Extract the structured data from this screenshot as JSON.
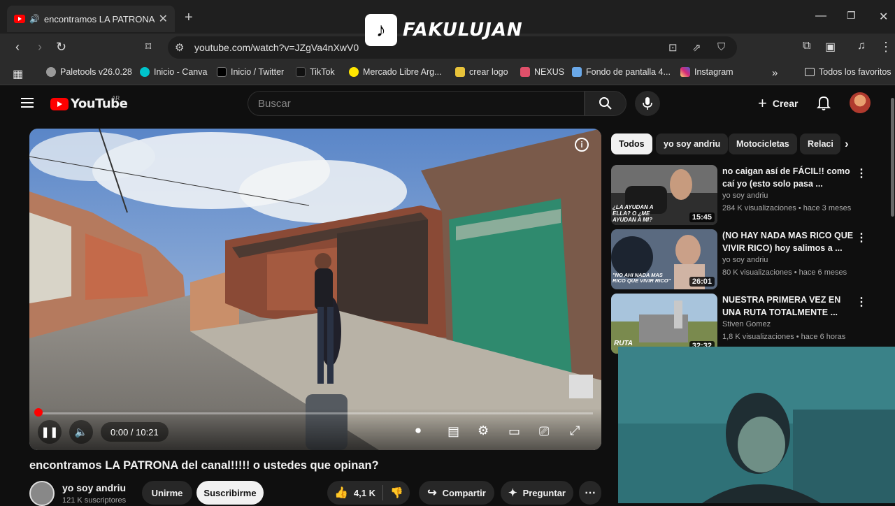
{
  "browser": {
    "tab_title": "encontramos LA PATRONA de",
    "url": "youtube.com/watch?v=JZgVa4nXwV0",
    "bookmarks": [
      {
        "label": "Paletools v26.0.28",
        "color": "#9a9a9a"
      },
      {
        "label": "Inicio - Canva",
        "color": "#00c4cc"
      },
      {
        "label": "Inicio / Twitter",
        "color": "#000000"
      },
      {
        "label": "TikTok",
        "color": "#111111"
      },
      {
        "label": "Mercado Libre Arg...",
        "color": "#ffe600"
      },
      {
        "label": "crear logo",
        "color": "#e8c33a"
      },
      {
        "label": "NEXUS",
        "color": "#e0506a"
      },
      {
        "label": "Fondo de pantalla 4...",
        "color": "#6aa8e8"
      },
      {
        "label": "Instagram",
        "color": "#d6249f"
      }
    ],
    "all_favorites": "Todos los favoritos"
  },
  "watermark": {
    "name": "FAKULUJAN"
  },
  "youtube": {
    "logo_text": "YouTube",
    "country": "AR",
    "search_placeholder": "Buscar",
    "create_label": "Crear"
  },
  "player": {
    "time": "0:00 / 10:21",
    "progress_fraction": 0.0
  },
  "video": {
    "title": "encontramos LA PATRONA del canal!!!!! o ustedes que opinan?",
    "channel": "yo soy andriu",
    "subscribers": "121 K suscriptores",
    "join": "Unirme",
    "subscribe": "Suscribirme",
    "likes": "4,1 K",
    "share": "Compartir",
    "ask": "Preguntar"
  },
  "chips": [
    "Todos",
    "yo soy andriu",
    "Motocicletas",
    "Relaci"
  ],
  "recommendations": [
    {
      "title": "no caigan así de FÁCIL!! como caí yo (esto solo pasa ...",
      "channel": "yo soy andriu",
      "meta": "284 K visualizaciones • hace 3 meses",
      "duration": "15:45",
      "thumb_text": "¿LA AYUDAN A ELLA? O ¿ME AYUDAN A MI?"
    },
    {
      "title": "(NO HAY NADA MAS RICO QUE VIVIR RICO) hoy salimos a ...",
      "channel": "yo soy andriu",
      "meta": "80 K visualizaciones • hace 6 meses",
      "duration": "26:01",
      "thumb_text": "\"NO AHI NADA MAS RICO QUE VIVIR RICO\""
    },
    {
      "title": "NUESTRA PRIMERA VEZ EN UNA RUTA TOTALMENTE ...",
      "channel": "Stiven Gomez",
      "meta": "1,8 K visualizaciones • hace 6 horas",
      "duration": "32:32",
      "thumb_text": "RUTA"
    }
  ]
}
